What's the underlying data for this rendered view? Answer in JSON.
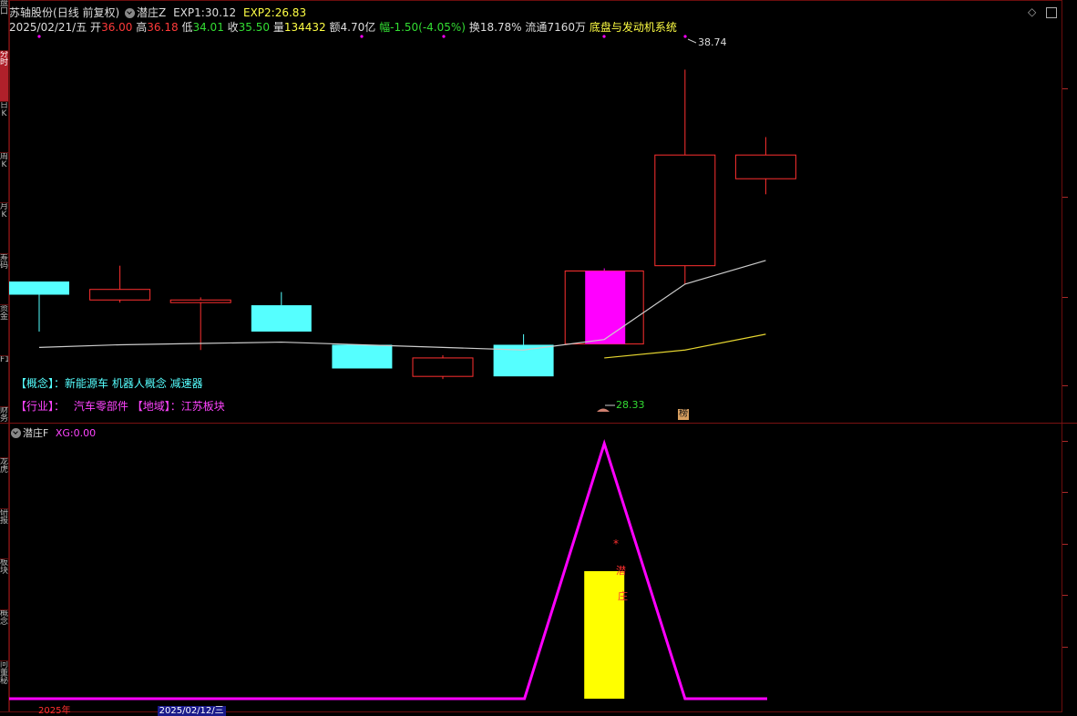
{
  "side_tabs": [
    "盘口",
    "分时",
    "日K",
    "周K",
    "月K",
    "筹码",
    "资金",
    "F10",
    "财务",
    "龙虎",
    "研报",
    "板块",
    "概念",
    "问董秘"
  ],
  "active_side_tab": 1,
  "header": {
    "stock_name": "苏轴股份",
    "period": "(日线 前复权)",
    "indicator_name": "潜庄Z",
    "exp1_label": "EXP1:",
    "exp1_value": "30.12",
    "exp2_label": "EXP2:",
    "exp2_value": "26.83"
  },
  "info": {
    "date": "2025/02/21/五",
    "open_label": "开",
    "open": "36.00",
    "high_label": "高",
    "high": "36.18",
    "low_label": "低",
    "low": "34.01",
    "close_label": "收",
    "close": "35.50",
    "volume_label": "量",
    "volume": "134432",
    "amount_label": "额",
    "amount": "4.70亿",
    "change_label": "幅",
    "change": "-1.50(-4.05%)",
    "turnover_label": "换",
    "turnover": "18.78%",
    "float_label": "流通",
    "float": "7160万",
    "sector": "底盘与发动机系统"
  },
  "annotations": {
    "high_marker": "38.74",
    "low_marker": "28.33",
    "badge": "榜",
    "concept_line": "【概念】：新能源车 机器人概念 减速器",
    "industry_label": "【行业】：",
    "industry_value": "汽车零部件",
    "region_label": "【地域】：",
    "region_value": "江苏板块"
  },
  "sub_panel": {
    "name": "潜庄F",
    "xg_label": "XG:",
    "xg_value": "0.00",
    "star": "*",
    "char1": "潜",
    "char2": "庄"
  },
  "date_bar": {
    "year": "2025年",
    "cursor_date": "2025/02/12/三"
  },
  "colors": {
    "bg": "#000000",
    "up": "#ff3030",
    "down": "#55ffff",
    "magenta": "#ff00ff",
    "yellow": "#ffff00",
    "ma_white": "#cccccc",
    "ma_yellow": "#e5d530",
    "frame": "#7a1212"
  },
  "chart_data": {
    "type": "candlestick",
    "ylim": [
      26,
      40
    ],
    "candles": [
      {
        "open": 30.7,
        "close": 30.2,
        "high": 30.7,
        "low": 28.8,
        "kind": "down"
      },
      {
        "open": 30.0,
        "close": 30.4,
        "high": 31.3,
        "low": 29.9,
        "kind": "up"
      },
      {
        "open": 29.9,
        "close": 30.0,
        "high": 30.1,
        "low": 28.1,
        "kind": "up"
      },
      {
        "open": 29.8,
        "close": 28.8,
        "high": 30.3,
        "low": 28.8,
        "kind": "down"
      },
      {
        "open": 28.3,
        "close": 27.4,
        "high": 28.3,
        "low": 27.4,
        "kind": "down"
      },
      {
        "open": 27.1,
        "close": 27.8,
        "high": 27.9,
        "low": 27.0,
        "kind": "up"
      },
      {
        "open": 28.3,
        "close": 27.1,
        "high": 28.7,
        "low": 27.1,
        "kind": "down"
      },
      {
        "open": 31.1,
        "close": 28.33,
        "high": 31.2,
        "low": 28.33,
        "kind": "limit-down"
      },
      {
        "open": 31.3,
        "close": 35.5,
        "high": 38.74,
        "low": 30.6,
        "kind": "up"
      },
      {
        "open": 34.6,
        "close": 35.5,
        "high": 36.18,
        "low": 34.01,
        "kind": "up"
      }
    ],
    "ma_white": [
      28.2,
      28.3,
      28.35,
      28.4,
      28.3,
      28.2,
      28.1,
      28.5,
      30.6,
      31.5
    ],
    "ma_yellow": [
      null,
      null,
      null,
      null,
      null,
      null,
      null,
      27.8,
      28.1,
      28.7
    ],
    "sub_line": [
      0,
      0,
      0,
      0,
      0,
      0,
      0,
      1,
      0,
      0
    ],
    "sub_bar": [
      0,
      0,
      0,
      0,
      0,
      0,
      0,
      0.5,
      0,
      0
    ]
  }
}
